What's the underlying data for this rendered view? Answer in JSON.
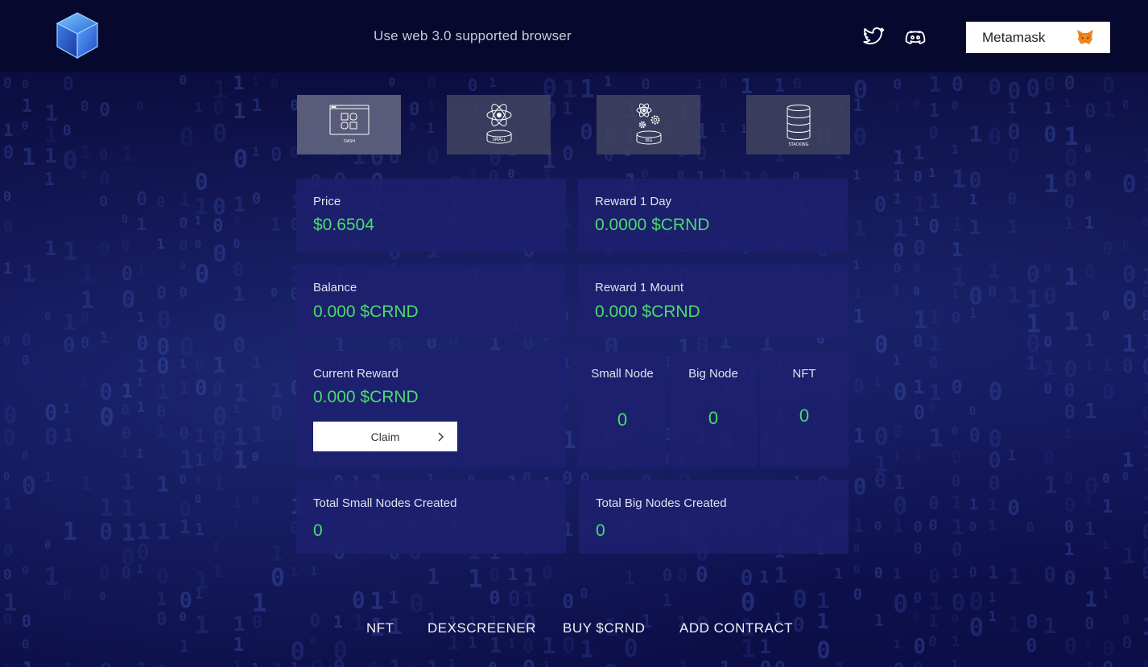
{
  "header": {
    "notice": "Use web 3.0 supported browser",
    "wallet_button": "Metamask",
    "icons": [
      "cube-logo-icon",
      "twitter-icon",
      "discord-icon",
      "metamask-fox-icon"
    ]
  },
  "nav_tabs": [
    {
      "id": "dash",
      "label": "DASH",
      "icon": "dashboard-icon"
    },
    {
      "id": "small",
      "label": "SMALL",
      "icon": "atom-icon"
    },
    {
      "id": "big",
      "label": "BIG",
      "icon": "atom-gears-icon"
    },
    {
      "id": "stacking",
      "label": "STACKING",
      "icon": "database-icon"
    }
  ],
  "stats": {
    "price": {
      "label": "Price",
      "value": "$0.6504"
    },
    "reward_day": {
      "label": "Reward 1 Day",
      "value": "0.0000 $CRND"
    },
    "balance": {
      "label": "Balance",
      "value": "0.000 $CRND"
    },
    "reward_month": {
      "label": "Reward 1 Mount",
      "value": "0.000 $CRND"
    },
    "current_reward": {
      "label": "Current Reward",
      "value": "0.000 $CRND",
      "button": "Claim"
    },
    "small_node": {
      "label": "Small Node",
      "value": "0"
    },
    "big_node": {
      "label": "Big Node",
      "value": "0"
    },
    "nft": {
      "label": "NFT",
      "value": "0"
    },
    "total_small": {
      "label": "Total Small Nodes Created",
      "value": "0"
    },
    "total_big": {
      "label": "Total Big Nodes Created",
      "value": "0"
    }
  },
  "footer": {
    "links": [
      "NFT",
      "DEXSCREENER",
      "BUY $CRND",
      "ADD CONTRACT"
    ]
  },
  "colors": {
    "accent_value": "#4cdb6e",
    "card_bg": "#1c206e",
    "header_bg": "#07082e",
    "page_bg": "#111457"
  }
}
